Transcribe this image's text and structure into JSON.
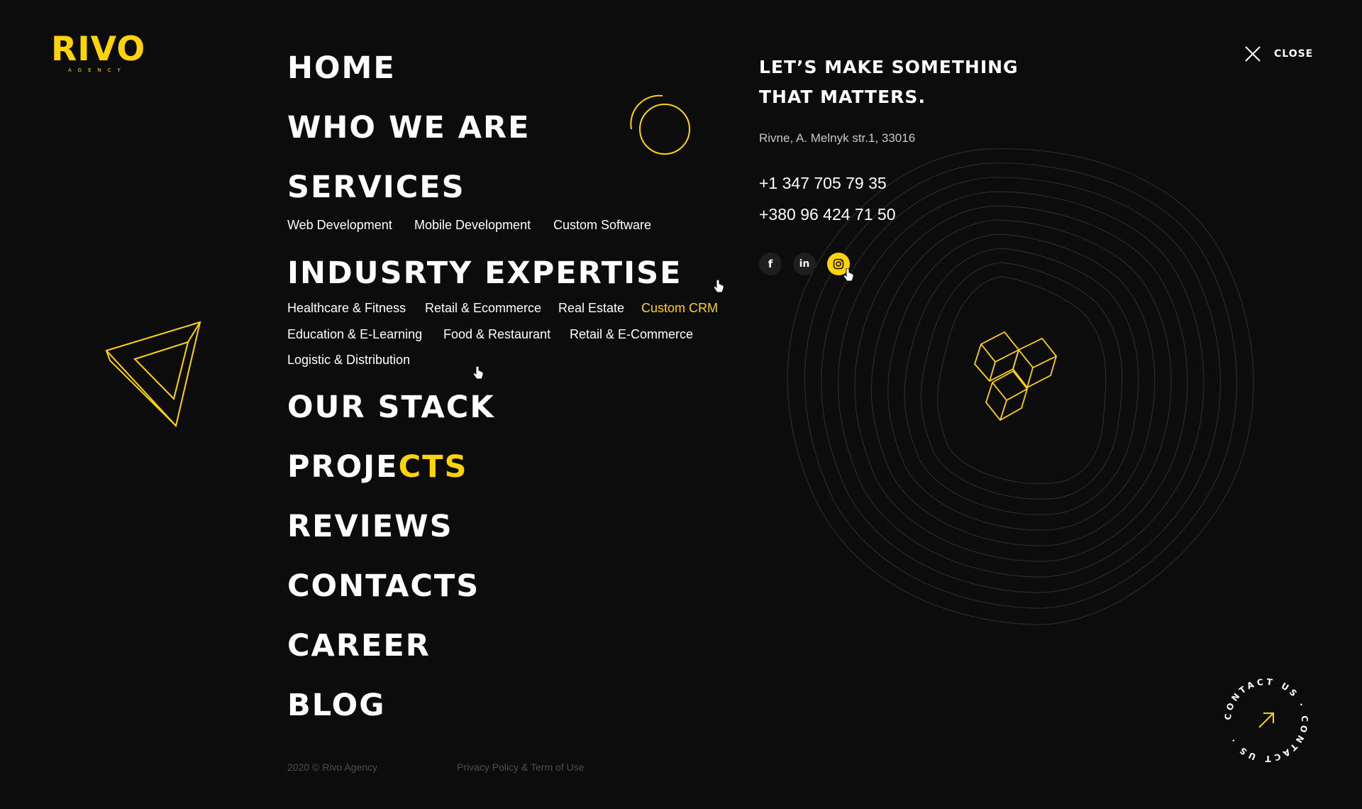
{
  "brand": {
    "name": "RIVO",
    "tagline": "AGENCY",
    "accent_color": "#ffd400",
    "background_color": "#0c0c0d"
  },
  "nav": {
    "home": "HOME",
    "who": "WHO WE ARE",
    "services": "SERVICES",
    "services_sub": [
      "Web Development",
      "Mobile Development",
      "Custom Software"
    ],
    "industry": "INDUSRTY EXPERTISE",
    "industry_sub": [
      "Healthcare & Fitness",
      "Retail & Ecommerce",
      "Real Estate",
      "Custom CRM",
      "Education & E-Learning",
      "Food & Restaurant",
      "Retail & E-Commerce",
      "Logistic & Distribution"
    ],
    "industry_active": "Custom CRM",
    "stack": "OUR STACK",
    "projects_a": "PROJE",
    "projects_b": "CTS",
    "reviews": "REVIEWS",
    "contacts": "CONTACTS",
    "career": "CAREER",
    "blog": "BLOG"
  },
  "contact_info": {
    "headline_line1": "LET’S MAKE SOMETHING",
    "headline_line2": "THAT MATTERS.",
    "address": "Rivne, A. Melnyk str.1, 33016",
    "phones": [
      "+1 347 705 79 35",
      "+380 96 424 71 50"
    ],
    "socials": [
      {
        "name": "facebook",
        "icon": "facebook-icon",
        "glyph": "f"
      },
      {
        "name": "linkedin",
        "icon": "linkedin-icon",
        "glyph": "in"
      },
      {
        "name": "instagram",
        "icon": "instagram-icon",
        "active": true
      }
    ]
  },
  "close": {
    "label": "CLOSE",
    "icon": "close-icon"
  },
  "footer": {
    "copyright": "2020 © Rivo Agency",
    "policy": "Privacy Policy & Term of Use"
  },
  "contact_badge": {
    "text": "CONTACT US · CONTACT US · ",
    "icon": "arrow-up-right-icon"
  }
}
